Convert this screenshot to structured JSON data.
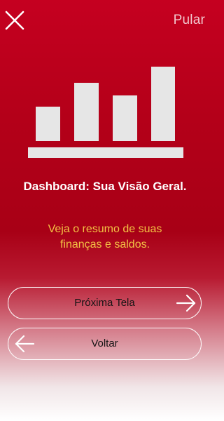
{
  "header": {
    "close_icon": "close-icon",
    "skip_label": "Pular"
  },
  "hero": {
    "icon": "bar-chart-icon",
    "bar_levels": [
      0.46,
      0.78,
      0.61,
      1.0
    ]
  },
  "content": {
    "title": "Dashboard: Sua Visão Geral.",
    "subtitle_line1": "Veja o resumo de suas",
    "subtitle_line2": "finanças e saldos."
  },
  "actions": {
    "next_label": "Próxima Tela",
    "next_icon": "arrow-right-icon",
    "back_label": "Voltar",
    "back_icon": "arrow-left-icon"
  },
  "colors": {
    "brand_red": "#c50020",
    "subtitle_gold": "#f3c244",
    "icon_light": "#e6e6e6"
  }
}
